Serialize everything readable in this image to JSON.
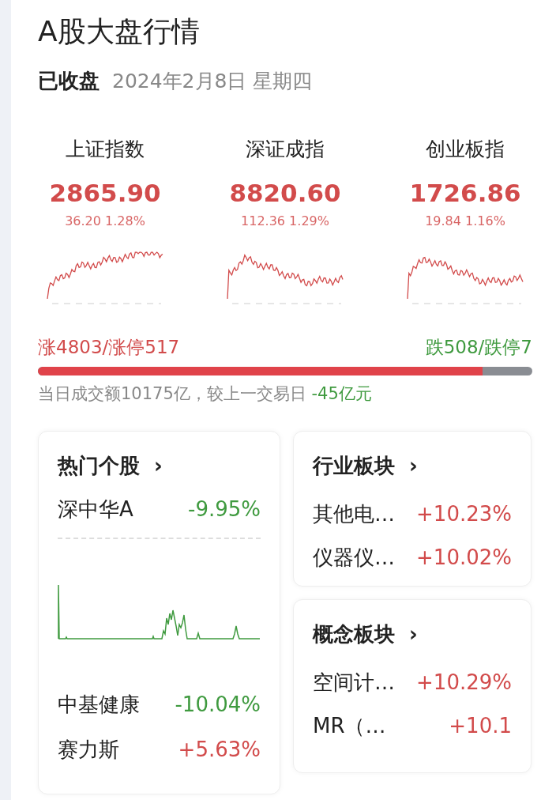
{
  "title": "A股大盘行情",
  "session": {
    "status": "已收盘",
    "date": "2024年2月8日 星期四"
  },
  "indices": [
    {
      "name": "上证指数",
      "value": "2865.90",
      "change": "36.20 1.28%",
      "color": "#d24b4b"
    },
    {
      "name": "深证成指",
      "value": "8820.60",
      "change": "112.36 1.29%",
      "color": "#d24b4b"
    },
    {
      "name": "创业板指",
      "value": "1726.86",
      "change": "19.84 1.16%",
      "color": "#d24b4b"
    }
  ],
  "breadth": {
    "up_text": "涨4803/涨停517",
    "down_text": "跌508/跌停7",
    "level": 0.9
  },
  "turnover": {
    "text": "当日成交额10175亿，较上一交易日",
    "delta": "-45亿元"
  },
  "hot_stocks": {
    "title": "热门个股",
    "arrow": "›",
    "featured": {
      "name": "深中华A",
      "change": "-9.95%",
      "color": "#3f9a3f"
    },
    "rows": [
      {
        "name": "中基健康",
        "change": "-10.04%",
        "color": "#3f9a3f"
      },
      {
        "name": "赛力斯",
        "change": "+5.63%",
        "color": "#d24b4b"
      }
    ]
  },
  "industry": {
    "title": "行业板块",
    "arrow": "›",
    "rows": [
      {
        "name": "其他电…",
        "change": "+10.23%",
        "color": "#d24b4b"
      },
      {
        "name": "仪器仪…",
        "change": "+10.02%",
        "color": "#d24b4b"
      }
    ]
  },
  "concept": {
    "title": "概念板块",
    "arrow": "›",
    "rows": [
      {
        "name": "空间计…",
        "change": "+10.29%",
        "color": "#d24b4b"
      },
      {
        "name": "MR（…",
        "change": "+10.1",
        "color": "#d24b4b"
      }
    ]
  }
}
